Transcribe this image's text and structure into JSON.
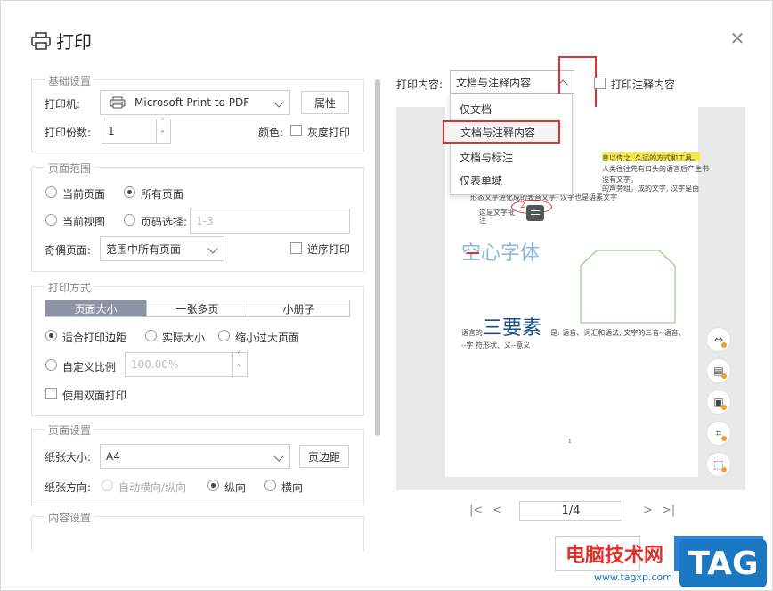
{
  "dialog": {
    "title": "打印"
  },
  "basic": {
    "legend": "基础设置",
    "printer_label": "打印机:",
    "printer_value": "Microsoft Print to PDF",
    "properties_button": "属性",
    "copies_label": "打印份数:",
    "copies_value": "1",
    "color_label": "颜色:",
    "grayscale_label": "灰度打印"
  },
  "range": {
    "legend": "页面范围",
    "current_page": "当前页面",
    "all_pages": "所有页面",
    "current_view": "当前视图",
    "page_select": "页码选择:",
    "page_select_placeholder": "1-3",
    "odd_even_label": "奇偶页面:",
    "odd_even_value": "范围中所有页面",
    "reverse_label": "逆序打印"
  },
  "mode": {
    "legend": "打印方式",
    "tabs": [
      "页面大小",
      "一张多页",
      "小册子"
    ],
    "fit_margins": "适合打印边距",
    "actual_size": "实际大小",
    "shrink_large": "缩小过大页面",
    "custom_scale": "自定义比例",
    "custom_scale_value": "100.00%",
    "duplex": "使用双面打印"
  },
  "paper": {
    "legend": "页面设置",
    "size_label": "纸张大小:",
    "size_value": "A4",
    "margins_button": "页边距",
    "orientation_label": "纸张方向:",
    "auto": "自动横向/纵向",
    "portrait": "纵向",
    "landscape": "横向"
  },
  "content_legend": "内容设置",
  "print_content": {
    "label": "打印内容:",
    "value": "文档与注释内容",
    "print_annotations": "打印注释内容",
    "options": [
      "仅文档",
      "文档与注释内容",
      "文档与标注",
      "仅表单域"
    ]
  },
  "preview": {
    "line1": "息以传之, 久远的方式和工具。",
    "line2": "人类往往先有口头的语言后产生书",
    "line3": "没有文字。",
    "line4": "的声旁组。成的文字, 汉字是由",
    "line5": "形态文字进化成的表音文字, 汉字也是语素文字",
    "line6": "这是文字批",
    "line7": "注",
    "annot_num": "2",
    "hollow_text": "空心字体",
    "three_text": "三要素",
    "line8": "语言的",
    "line9": "是: 语音、词汇和语法, 文字的三音--语音、",
    "line10": "--字 符形状、义--意义",
    "page_num": "1"
  },
  "pager": {
    "value": "1/4"
  },
  "watermark": {
    "text": "电脑技术网",
    "url": "www.tagxp.com",
    "tag": "TAG"
  },
  "colors": {
    "accent": "#8d93a7",
    "red": "#e0302a",
    "watermark_blue": "#1a78c2"
  }
}
